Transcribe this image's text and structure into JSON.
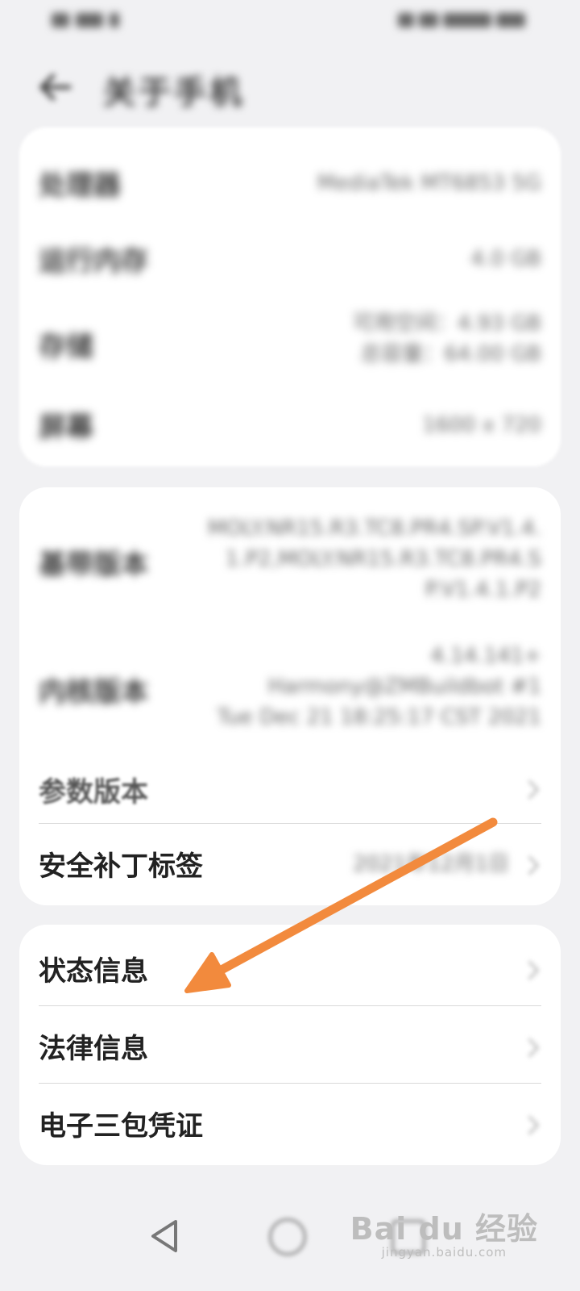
{
  "status_bar": {
    "left_icons": "signal-icon",
    "right_icons": "battery-icon"
  },
  "header": {
    "title": "关于手机",
    "back_icon": "back-arrow-icon"
  },
  "card1": {
    "rows": [
      {
        "label": "处理器",
        "value": "MediaTek MT6853 5G"
      },
      {
        "label": "运行内存",
        "value": "4.0 GB"
      },
      {
        "label": "存储",
        "value_lines": [
          "可用空间：4.93 GB",
          "总容量：64.00 GB"
        ]
      },
      {
        "label": "屏幕",
        "value": "1600 x 720"
      }
    ]
  },
  "card2": {
    "rows": [
      {
        "label": "基带版本",
        "value_lines": [
          "MOLY.NR15.R3.TC8.PR4.SP.V1.4.",
          "1.P2,MOLY.NR15.R3.TC8.PR4.S",
          "P.V1.4.1.P2"
        ]
      },
      {
        "label": "内核版本",
        "value_lines": [
          "4.14.141+",
          "Harmony@ZMBuildbot #1",
          "Tue Dec 21 18:25:17 CST 2021"
        ]
      },
      {
        "label": "参数版本"
      },
      {
        "label": "安全补丁标签",
        "value": "2021年12月1日"
      }
    ]
  },
  "card3": {
    "rows": [
      {
        "label": "状态信息"
      },
      {
        "label": "法律信息"
      },
      {
        "label": "电子三包凭证"
      }
    ]
  },
  "annotation": {
    "arrow_color": "#f28a3d",
    "icon": "orange-arrow-icon"
  },
  "nav_bar": {
    "back": "triangle-back-icon",
    "home": "circle-home-icon",
    "recent": "square-recent-icon"
  },
  "watermark": {
    "brand": "Bai du 经验",
    "url": "jingyan.baidu.com"
  }
}
